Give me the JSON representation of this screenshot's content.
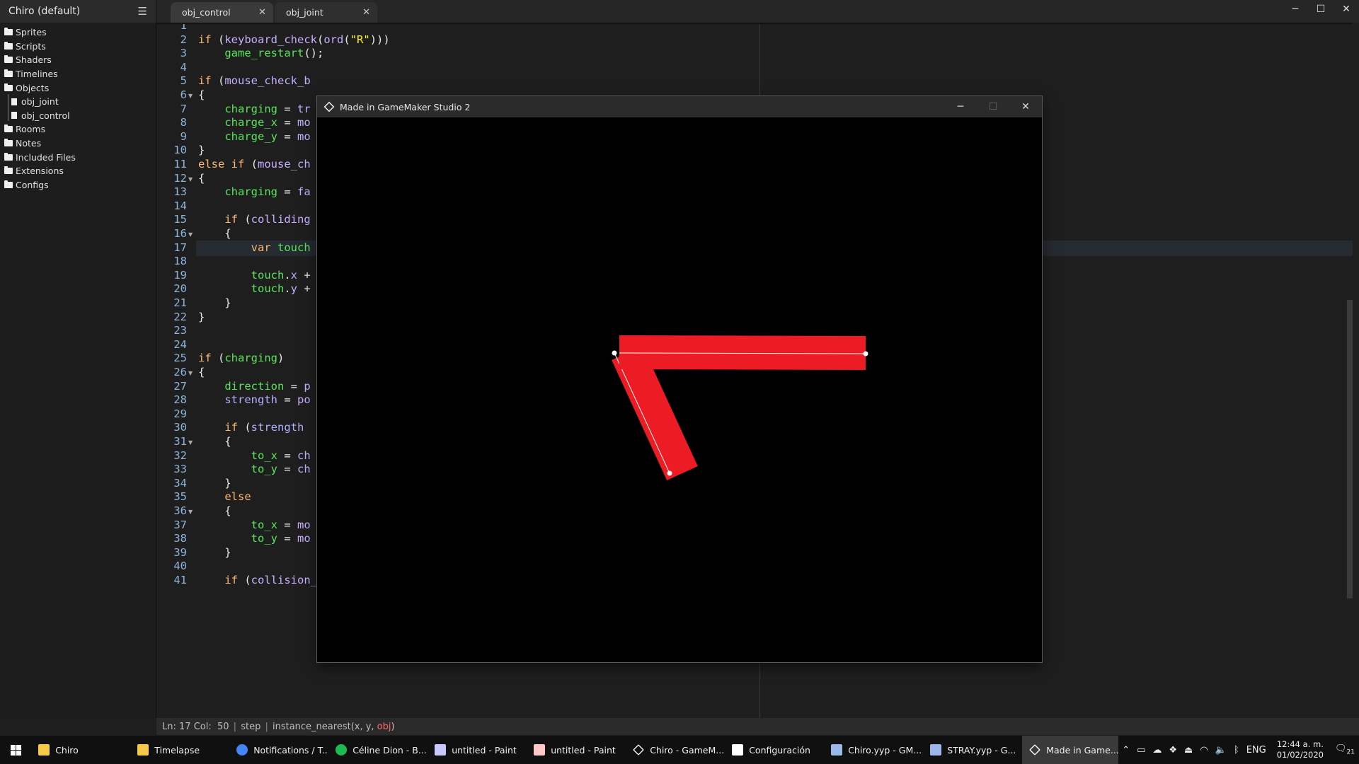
{
  "project": {
    "title": "Chiro (default)"
  },
  "resources": {
    "items": [
      {
        "label": "Sprites",
        "type": "folder"
      },
      {
        "label": "Scripts",
        "type": "folder"
      },
      {
        "label": "Shaders",
        "type": "folder"
      },
      {
        "label": "Timelines",
        "type": "folder"
      },
      {
        "label": "Objects",
        "type": "folder-open"
      },
      {
        "label": "obj_joint",
        "type": "file"
      },
      {
        "label": "obj_control",
        "type": "file"
      },
      {
        "label": "Rooms",
        "type": "folder"
      },
      {
        "label": "Notes",
        "type": "folder"
      },
      {
        "label": "Included Files",
        "type": "folder"
      },
      {
        "label": "Extensions",
        "type": "folder"
      },
      {
        "label": "Configs",
        "type": "folder"
      }
    ]
  },
  "tabs": [
    {
      "label": "obj_control",
      "active": true
    },
    {
      "label": "obj_joint",
      "active": false
    }
  ],
  "editor": {
    "current_line": 17,
    "fold_lines": [
      6,
      12,
      16,
      26,
      31,
      36
    ],
    "lines": [
      "",
      "if (keyboard_check(ord(\"R\")))",
      "    game_restart();",
      "",
      "if (mouse_check_b",
      "{",
      "    charging = tr",
      "    charge_x = mo",
      "    charge_y = mo",
      "}",
      "else if (mouse_ch",
      "{",
      "    charging = fa",
      "",
      "    if (colliding",
      "    {",
      "        var touch",
      "",
      "        touch.x +",
      "        touch.y +",
      "    }",
      "}",
      "",
      "",
      "if (charging)",
      "{",
      "    direction = p",
      "    strength = po",
      "",
      "    if (strength",
      "    {",
      "        to_x = ch",
      "        to_y = ch",
      "    }",
      "    else",
      "    {",
      "        to_x = mo",
      "        to_y = mo",
      "    }",
      "",
      "    if (collision_line(charge_x, charge_y, to_x, to_y, obj_joint, true, true) != noone)"
    ]
  },
  "status": {
    "ln_label": "Ln:",
    "ln_value": "17",
    "col_label": "Col:",
    "col_value": "50",
    "event": "step",
    "hint_prefix": "instance_nearest(x, y, ",
    "hint_arg": "obj",
    "hint_suffix": ")"
  },
  "game_window": {
    "title": "Made in GameMaker Studio 2",
    "scene": {
      "segments": [
        {
          "color": "#ed1c24"
        }
      ]
    }
  },
  "window_controls": {
    "minimize": "─",
    "maximize": "☐",
    "close": "✕"
  },
  "taskbar": {
    "items": [
      {
        "label": "Chiro",
        "icon": "folder-icon",
        "color": "#f7c948"
      },
      {
        "label": "Timelapse",
        "icon": "folder-icon",
        "color": "#f7c948"
      },
      {
        "label": "Notifications / T...",
        "icon": "chrome-icon",
        "color": "#4285f4"
      },
      {
        "label": "Céline Dion - B...",
        "icon": "spotify-icon",
        "color": "#1db954"
      },
      {
        "label": "untitled - Paint",
        "icon": "paint-icon",
        "color": "#c8c8ff"
      },
      {
        "label": "untitled - Paint",
        "icon": "paint-icon",
        "color": "#ffc8c8"
      },
      {
        "label": "Chiro - GameM...",
        "icon": "gamemaker-icon",
        "color": "#ffffff"
      },
      {
        "label": "Configuración",
        "icon": "gear-icon",
        "color": "#ffffff"
      },
      {
        "label": "Chiro.yyp - GM...",
        "icon": "gms-ide-icon",
        "color": "#9ab8e8"
      },
      {
        "label": "STRAY.yyp - G...",
        "icon": "gms-ide-icon",
        "color": "#9ab8e8"
      },
      {
        "label": "Made in Game...",
        "icon": "gamemaker-icon",
        "color": "#ffffff",
        "active": true
      }
    ],
    "language": "ENG",
    "time": "12:44 a. m.",
    "date": "01/02/2020",
    "notification_count": "21"
  }
}
